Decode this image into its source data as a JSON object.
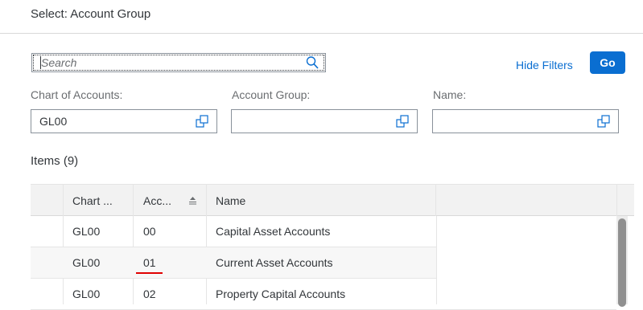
{
  "dialog": {
    "title": "Select: Account Group"
  },
  "search": {
    "placeholder": "Search",
    "value": ""
  },
  "toolbar": {
    "hide_filters_label": "Hide Filters",
    "go_label": "Go"
  },
  "filters": [
    {
      "label": "Chart of Accounts:",
      "value": "GL00"
    },
    {
      "label": "Account Group:",
      "value": ""
    },
    {
      "label": "Name:",
      "value": ""
    }
  ],
  "items": {
    "title": "Items (9)",
    "columns": [
      "Chart ...",
      "Acc...",
      "Name"
    ],
    "sort_icon": "sort-ascending-icon",
    "rows": [
      {
        "chart": "GL00",
        "group": "00",
        "name": "Capital Asset Accounts"
      },
      {
        "chart": "GL00",
        "group": "01",
        "name": "Current Asset Accounts"
      },
      {
        "chart": "GL00",
        "group": "02",
        "name": "Property Capital Accounts"
      }
    ]
  },
  "colors": {
    "accent": "#0a6ed1",
    "header_bg": "#f2f2f2",
    "alt_row": "#f7f7f7",
    "highlight_underline": "#e00000"
  }
}
